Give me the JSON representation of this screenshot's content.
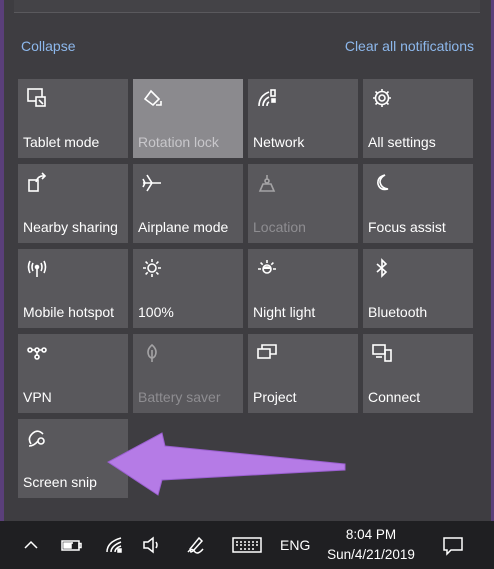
{
  "action_center": {
    "collapse_label": "Collapse",
    "clear_label": "Clear all notifications",
    "accent_color": "#8db8ec",
    "tiles": [
      {
        "label": "Tablet mode",
        "icon": "tablet-mode-icon",
        "state": "normal"
      },
      {
        "label": "Rotation lock",
        "icon": "rotation-lock-icon",
        "state": "active"
      },
      {
        "label": "Network",
        "icon": "network-icon",
        "state": "normal"
      },
      {
        "label": "All settings",
        "icon": "gear-icon",
        "state": "normal"
      },
      {
        "label": "Nearby sharing",
        "icon": "nearby-sharing-icon",
        "state": "normal"
      },
      {
        "label": "Airplane mode",
        "icon": "airplane-icon",
        "state": "normal"
      },
      {
        "label": "Location",
        "icon": "location-icon",
        "state": "disabled"
      },
      {
        "label": "Focus assist",
        "icon": "moon-icon",
        "state": "normal"
      },
      {
        "label": "Mobile hotspot",
        "icon": "hotspot-icon",
        "state": "normal"
      },
      {
        "label": "100%",
        "icon": "brightness-icon",
        "state": "normal"
      },
      {
        "label": "Night light",
        "icon": "night-light-icon",
        "state": "normal"
      },
      {
        "label": "Bluetooth",
        "icon": "bluetooth-icon",
        "state": "normal"
      },
      {
        "label": "VPN",
        "icon": "vpn-icon",
        "state": "normal"
      },
      {
        "label": "Battery saver",
        "icon": "battery-saver-icon",
        "state": "disabled"
      },
      {
        "label": "Project",
        "icon": "project-icon",
        "state": "normal"
      },
      {
        "label": "Connect",
        "icon": "connect-icon",
        "state": "normal"
      },
      {
        "label": "Screen snip",
        "icon": "screen-snip-icon",
        "state": "normal"
      }
    ]
  },
  "annotation": {
    "arrow_color": "#b57be6"
  },
  "taskbar": {
    "language": "ENG",
    "time": "8:04 PM",
    "date": "Sun/4/21/2019"
  }
}
